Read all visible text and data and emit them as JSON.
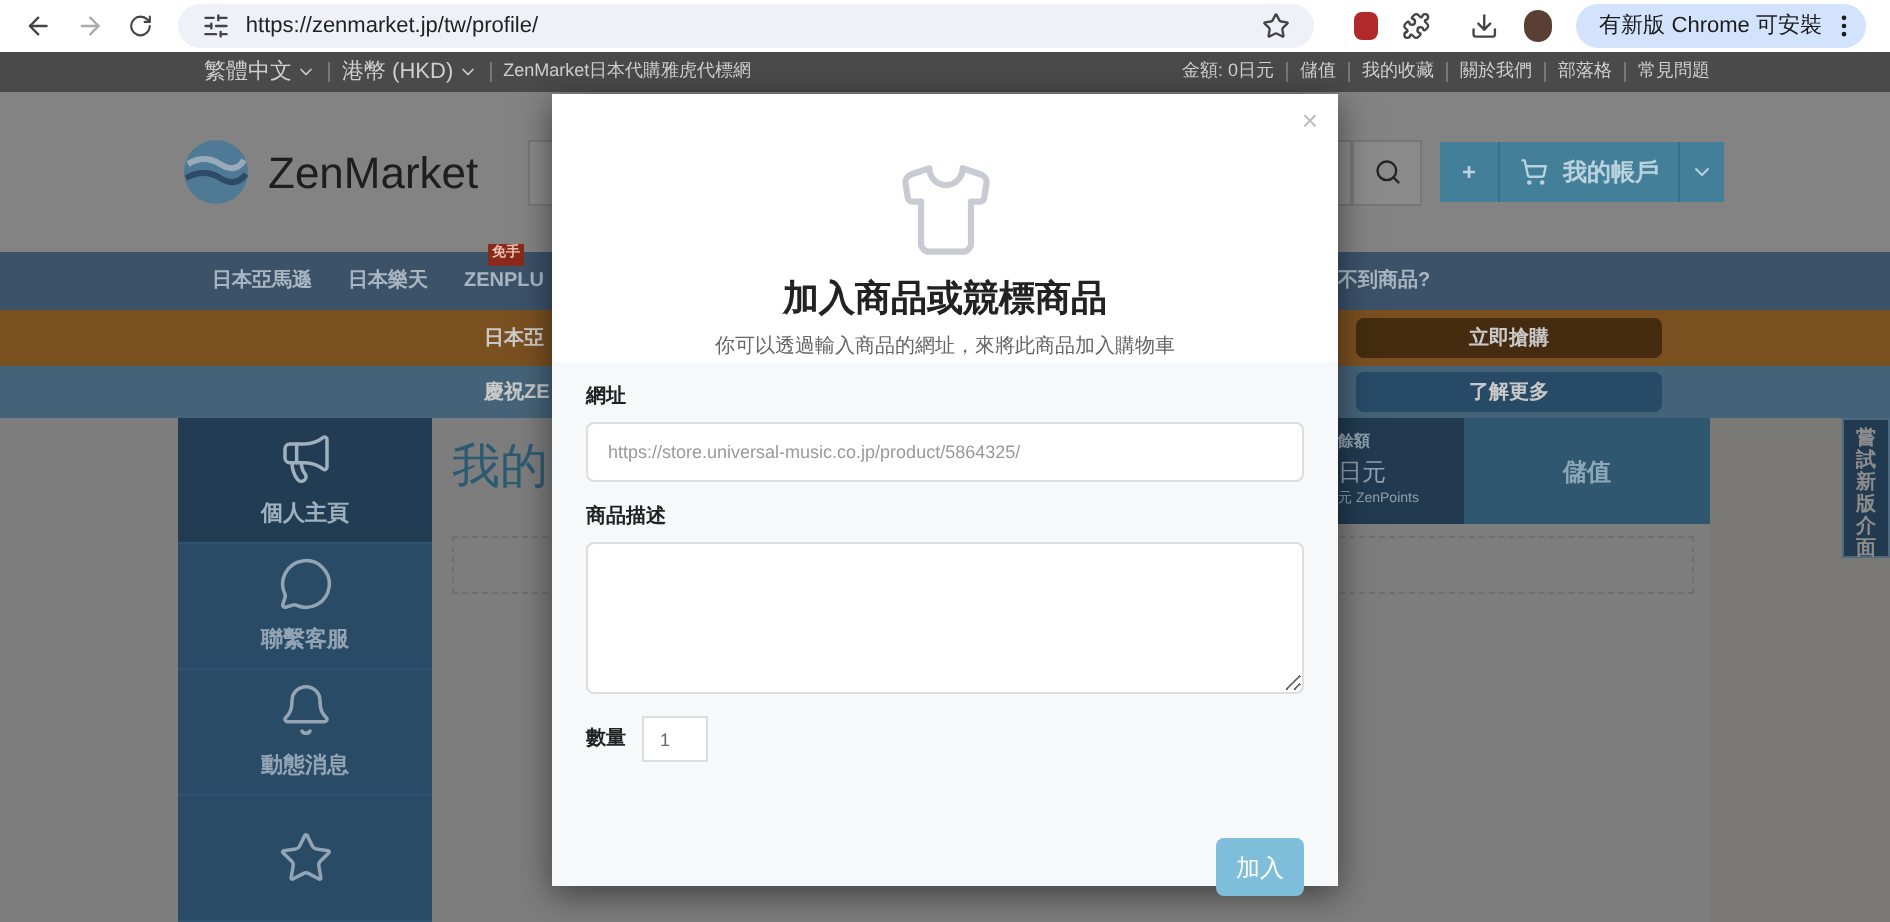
{
  "browser": {
    "url": "https://zenmarket.jp/tw/profile/",
    "update_button": "有新版 Chrome 可安裝"
  },
  "top_bar": {
    "left": [
      {
        "label": "繁體中文",
        "dropdown": true
      },
      {
        "label": "港幣 (HKD)",
        "dropdown": true
      },
      {
        "label": "ZenMarket日本代購雅虎代標網",
        "dropdown": false
      }
    ],
    "right": [
      "金額: 0日元",
      "儲值",
      "我的收藏",
      "關於我們",
      "部落格",
      "常見問題"
    ]
  },
  "header": {
    "logo": "ZenMarket",
    "account_plus": "+",
    "account_label": "我的帳戶"
  },
  "nav": {
    "items": [
      {
        "label": "日本亞馬遜"
      },
      {
        "label": "日本樂天"
      },
      {
        "label": "ZENPLU",
        "badge": "免手"
      }
    ],
    "right_text": "不到商品?"
  },
  "promo_bars": [
    {
      "kind": "orange",
      "text": "日本亞",
      "button": "立即搶購"
    },
    {
      "kind": "blue",
      "text": "慶祝ZE",
      "button": "了解更多"
    }
  ],
  "sidebar": [
    {
      "label": "個人主頁",
      "selected": true
    },
    {
      "label": "聯繫客服",
      "selected": false
    },
    {
      "label": "動態消息",
      "selected": false
    },
    {
      "selected": false
    }
  ],
  "main": {
    "heading": "我的",
    "balance": {
      "caption": "餘額",
      "amount": "日元",
      "points": "元 ZenPoints"
    },
    "topup": "儲值"
  },
  "side_tab": "嘗試新版介面",
  "modal": {
    "title": "加入商品或競標商品",
    "subtitle": "你可以透過輸入商品的網址，來將此商品加入購物車",
    "close": "×",
    "fields": [
      {
        "kind": "input",
        "label": "網址",
        "placeholder": "https://store.universal-music.co.jp/product/5864325/"
      },
      {
        "kind": "textarea",
        "label": "商品描述"
      }
    ],
    "quantity": {
      "label": "數量",
      "value": "1"
    },
    "submit": "加入"
  }
}
